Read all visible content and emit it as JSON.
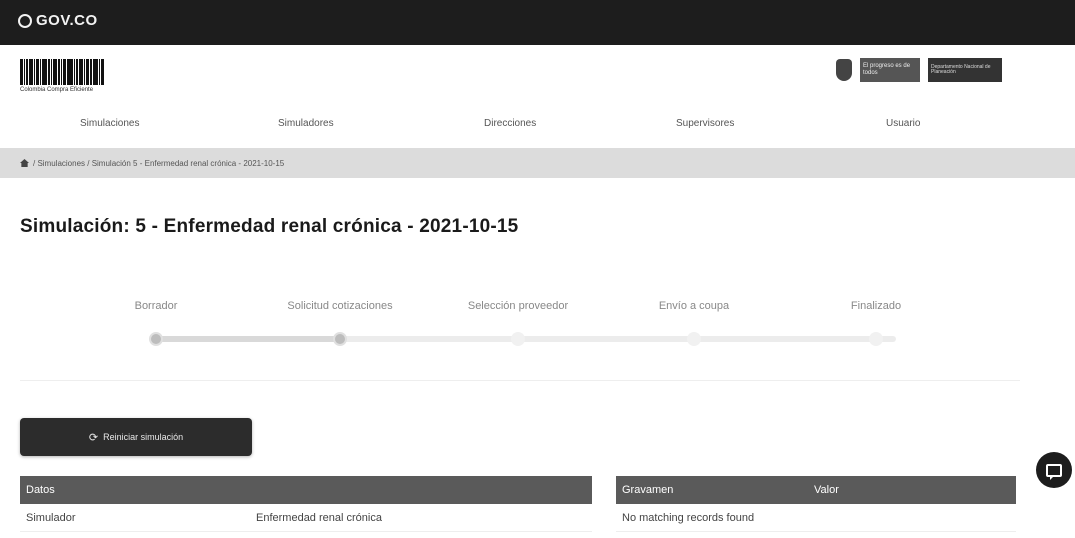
{
  "topbar": {
    "logo_text": "GOV.CO"
  },
  "header": {
    "brand_caption": "Colombia Compra Eficiente",
    "partner_logo_a": "El progreso es de todos",
    "partner_logo_b": "Departamento Nacional de Planeación"
  },
  "nav": {
    "items": [
      "Simulaciones",
      "Simuladores",
      "Direcciones",
      "Supervisores",
      "Usuario"
    ]
  },
  "breadcrumb": {
    "path": "/ Simulaciones / Simulación 5 - Enfermedad renal crónica - 2021-10-15"
  },
  "page": {
    "title": "Simulación: 5 - Enfermedad renal crónica - 2021-10-15"
  },
  "stepper": {
    "steps": [
      "Borrador",
      "Solicitud cotizaciones",
      "Selección proveedor",
      "Envío a coupa",
      "Finalizado"
    ],
    "completed": 2
  },
  "action": {
    "label": "Reiniciar simulación"
  },
  "datos_table": {
    "header": "Datos",
    "rows": [
      {
        "label": "Simulador",
        "value": "Enfermedad renal crónica"
      }
    ]
  },
  "gravamen_table": {
    "col1": "Gravamen",
    "col2": "Valor",
    "empty_text": "No matching records found"
  },
  "icons": {
    "home": "home-icon",
    "refresh": "refresh-icon",
    "chat": "chat-icon"
  }
}
